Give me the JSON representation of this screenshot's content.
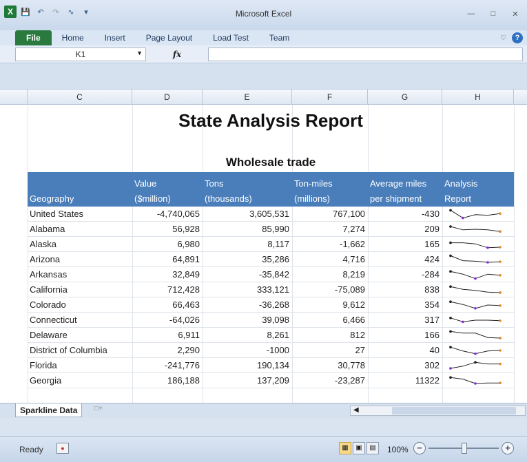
{
  "window": {
    "title": "Microsoft Excel"
  },
  "ribbon": {
    "tabs": [
      {
        "id": "file",
        "label": "File"
      },
      {
        "id": "home",
        "label": "Home"
      },
      {
        "id": "insert",
        "label": "Insert"
      },
      {
        "id": "page-layout",
        "label": "Page Layout"
      },
      {
        "id": "load-test",
        "label": "Load Test"
      },
      {
        "id": "team",
        "label": "Team"
      }
    ]
  },
  "formula_bar": {
    "name_box": "K1",
    "fx": "fx",
    "value": ""
  },
  "columns": [
    "C",
    "D",
    "E",
    "F",
    "G",
    "H"
  ],
  "report": {
    "title": "State Analysis Report",
    "subtitle": "Wholesale trade",
    "headers": {
      "geography": "Geography",
      "value_l1": "Value",
      "value_l2": "($million)",
      "tons_l1": "Tons",
      "tons_l2": "(thousands)",
      "tonmiles_l1": "Ton-miles",
      "tonmiles_l2": "(millions)",
      "avg_l1": "Average miles",
      "avg_l2": "per shipment",
      "analysis_l1": "Analysis",
      "analysis_l2": "Report"
    },
    "rows": [
      {
        "geo": "United States",
        "value": "-4,740,065",
        "tons": "3,605,531",
        "tonmiles": "767,100",
        "avg": "-430"
      },
      {
        "geo": "Alabama",
        "value": "56,928",
        "tons": "85,990",
        "tonmiles": "7,274",
        "avg": "209"
      },
      {
        "geo": "Alaska",
        "value": "6,980",
        "tons": "8,117",
        "tonmiles": "-1,662",
        "avg": "165"
      },
      {
        "geo": "Arizona",
        "value": "64,891",
        "tons": "35,286",
        "tonmiles": "4,716",
        "avg": "424"
      },
      {
        "geo": "Arkansas",
        "value": "32,849",
        "tons": "-35,842",
        "tonmiles": "8,219",
        "avg": "-284"
      },
      {
        "geo": "California",
        "value": "712,428",
        "tons": "333,121",
        "tonmiles": "-75,089",
        "avg": "838"
      },
      {
        "geo": "Colorado",
        "value": "66,463",
        "tons": "-36,268",
        "tonmiles": "9,612",
        "avg": "354"
      },
      {
        "geo": "Connecticut",
        "value": "-64,026",
        "tons": "39,098",
        "tonmiles": "6,466",
        "avg": "317"
      },
      {
        "geo": "Delaware",
        "value": "6,911",
        "tons": "8,261",
        "tonmiles": "812",
        "avg": "166"
      },
      {
        "geo": "District of Columbia",
        "value": "2,290",
        "tons": "-1000",
        "tonmiles": "27",
        "avg": "40"
      },
      {
        "geo": "Florida",
        "value": "-241,776",
        "tons": "190,134",
        "tonmiles": "30,778",
        "avg": "302"
      },
      {
        "geo": "Georgia",
        "value": "186,188",
        "tons": "137,209",
        "tonmiles": "-23,287",
        "avg": "11322"
      }
    ]
  },
  "sparkline_colors": {
    "line": "#222222",
    "high": "#2a9d3a",
    "low": "#8a2be2",
    "last": "#e08a1e"
  },
  "sheet_tabs": [
    {
      "label": "Sparkline Data"
    }
  ],
  "status": {
    "ready": "Ready",
    "zoom": "100%"
  }
}
